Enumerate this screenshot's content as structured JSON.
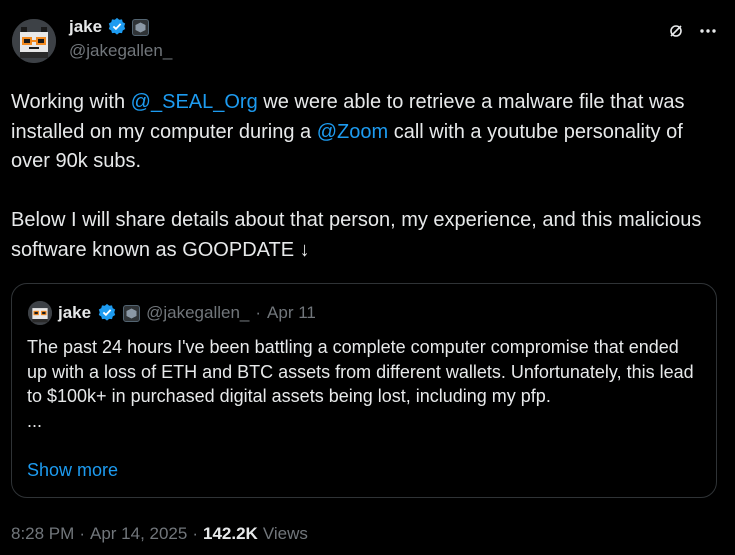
{
  "author": {
    "display_name": "jake",
    "handle": "@jakegallen_"
  },
  "tweet": {
    "text_1": "Working with ",
    "mention_1": "@_SEAL_Org",
    "text_2": " we were able to retrieve a malware file that was installed on my computer during a ",
    "mention_2": "@Zoom",
    "text_3": " call with a youtube personality of over 90k subs.\n\nBelow I will share details about that person, my experience, and this malicious software known as GOOPDATE ↓"
  },
  "quote": {
    "display_name": "jake",
    "handle": "@jakegallen_",
    "separator": "·",
    "date": "Apr 11",
    "text": "The past 24 hours I've been battling a complete computer compromise that ended up with a loss of ETH and BTC assets from different wallets. Unfortunately, this lead to $100k+ in purchased digital assets being lost, including my pfp.",
    "ellipsis": "...",
    "show_more": "Show more"
  },
  "footer": {
    "time": "8:28 PM",
    "sep1": "·",
    "date": "Apr 14, 2025",
    "sep2": "·",
    "views_count": "142.2K",
    "views_label": "Views"
  },
  "colors": {
    "background": "#000000",
    "text": "#e7e9ea",
    "muted": "#71767b",
    "link": "#1d9bf0",
    "border": "#2f3336"
  },
  "icons": [
    "avatar-image",
    "verified-badge-icon",
    "affiliate-badge-icon",
    "grok-icon",
    "more-icon"
  ]
}
